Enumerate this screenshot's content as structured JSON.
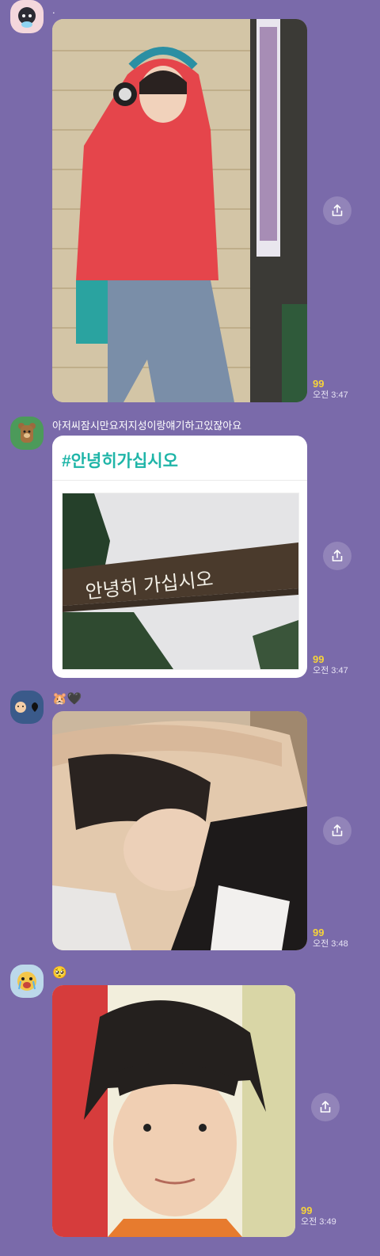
{
  "messages": [
    {
      "sender": ".",
      "read_count": "99",
      "time": "오전 3:47"
    },
    {
      "sender": "아저씨잠시만요저지성이랑얘기하고있잖아요",
      "card_title": "#안녕히가십시오",
      "sign_text": "안녕히 가십시오",
      "read_count": "99",
      "time": "오전 3:47"
    },
    {
      "sender": "🐹🖤",
      "read_count": "99",
      "time": "오전 3:48"
    },
    {
      "sender": "🥺",
      "read_count": "99",
      "time": "오전 3:49"
    }
  ],
  "icons": {
    "share": "share-icon",
    "avatar1": "penguin-character-icon",
    "avatar2": "bear-character-icon",
    "avatar3": "hamster-heart-icon",
    "avatar4": "crying-character-icon"
  },
  "colors": {
    "background": "#7a6aaa",
    "read_count": "#f6d33a",
    "card_title": "#1fb5a8"
  }
}
